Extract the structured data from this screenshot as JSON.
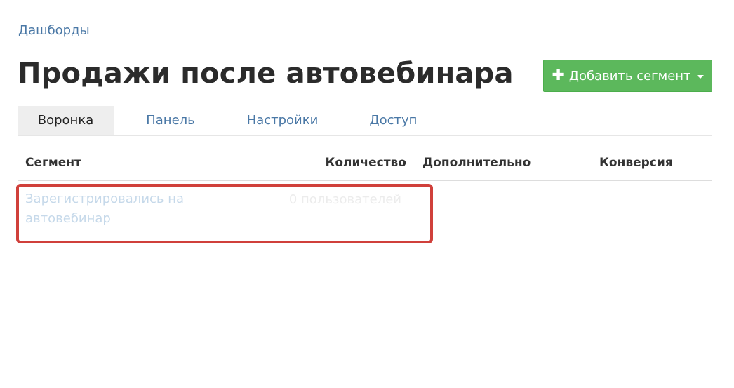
{
  "breadcrumb": {
    "label": "Дашборды"
  },
  "page": {
    "title": "Продажи после автовебинара"
  },
  "actions": {
    "add_segment_label": "Добавить сегмент",
    "add_segment_icon": "plus-icon",
    "dropdown_icon": "caret-down-icon",
    "button_color": "#5cb85c"
  },
  "tabs": [
    {
      "label": "Воронка",
      "active": true
    },
    {
      "label": "Панель",
      "active": false
    },
    {
      "label": "Настройки",
      "active": false
    },
    {
      "label": "Доступ",
      "active": false
    }
  ],
  "table": {
    "columns": [
      "Сегмент",
      "Количество",
      "Дополнительно",
      "Конверсия"
    ],
    "rows": [
      {
        "segment": "Зарегистрировались на автовебинар",
        "count": "0 пользователей",
        "extra": "",
        "conversion": ""
      }
    ]
  },
  "colors": {
    "link": "#4a78a6",
    "highlight": "#d0403b"
  }
}
